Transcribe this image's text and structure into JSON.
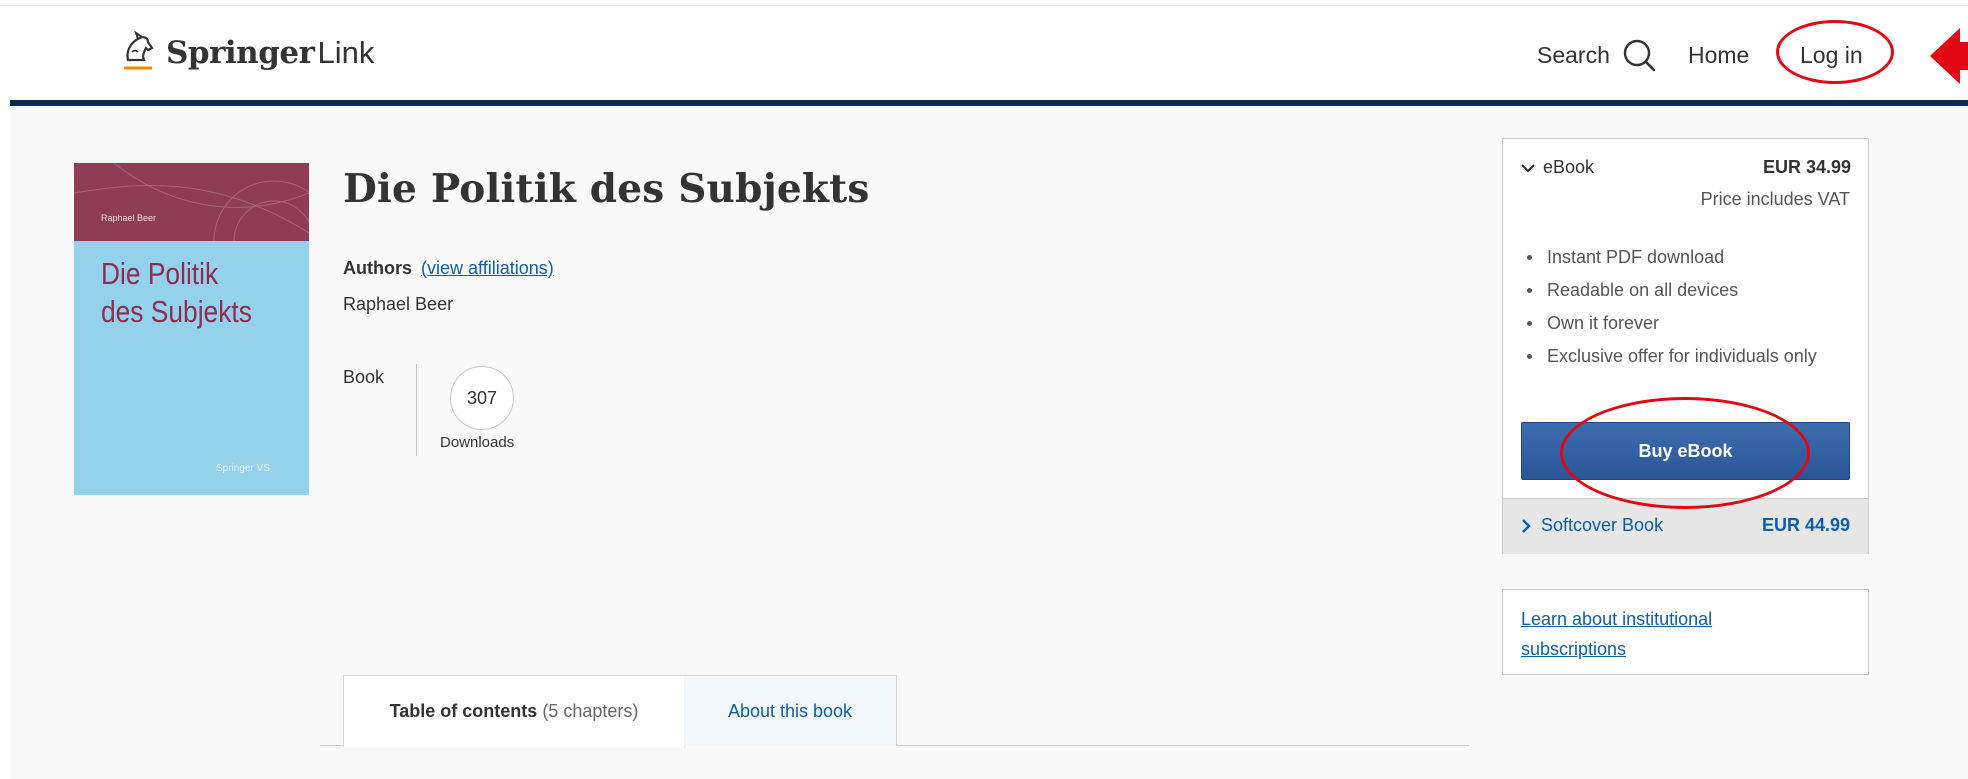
{
  "header": {
    "logo_brand": "Springer",
    "logo_suffix": "Link",
    "nav": {
      "search": "Search",
      "home": "Home",
      "login": "Log in"
    }
  },
  "book": {
    "cover": {
      "author": "Raphael Beer",
      "title_line1": "Die Politik",
      "title_line2": "des Subjekts",
      "publisher": "Springer VS"
    },
    "title": "Die Politik des Subjekts",
    "authors_label": "Authors",
    "affiliations_link": "(view affiliations)",
    "author_name": "Raphael Beer",
    "type": "Book",
    "downloads_count": "307",
    "downloads_label": "Downloads"
  },
  "tabs": {
    "toc_label": "Table of contents",
    "toc_count": "(5 chapters)",
    "about_label": "About this book"
  },
  "purchase": {
    "ebook_label": "eBook",
    "ebook_price": "EUR 34.99",
    "vat_note": "Price includes VAT",
    "features": [
      "Instant PDF download",
      "Readable on all devices",
      "Own it forever",
      "Exclusive offer for individuals only"
    ],
    "buy_button": "Buy eBook",
    "softcover_label": "Softcover Book",
    "softcover_price": "EUR 44.99"
  },
  "institutional": {
    "link": "Learn about institutional subscriptions"
  },
  "colors": {
    "header_bar": "#0b2a4d",
    "link": "#0c5fa8",
    "buy_button": "#2f5d9f",
    "annotation": "#e30613",
    "cover_blue": "#94d1ec",
    "cover_maroon": "#8f3d55"
  },
  "icons": {
    "logo": "springer-horse-logo-icon",
    "search": "search-icon",
    "ebook_expand": "chevron-down-icon",
    "softcover_expand": "chevron-right-icon",
    "annotation_arrow": "arrow-left-icon"
  }
}
